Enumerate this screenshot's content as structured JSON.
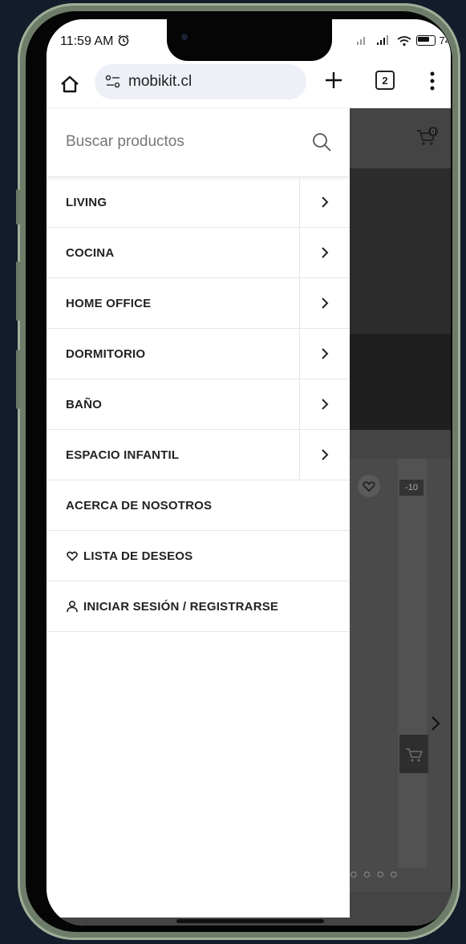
{
  "status_bar": {
    "time": "11:59 AM",
    "battery": "74"
  },
  "browser": {
    "url": "mobikit.cl",
    "tab_count": "2"
  },
  "drawer": {
    "search_placeholder": "Buscar productos",
    "menu": [
      {
        "label": "LIVING",
        "has_submenu": true
      },
      {
        "label": "COCINA",
        "has_submenu": true
      },
      {
        "label": "HOME OFFICE",
        "has_submenu": true
      },
      {
        "label": "DORMITORIO",
        "has_submenu": true
      },
      {
        "label": "BAÑO",
        "has_submenu": true
      },
      {
        "label": "ESPACIO INFANTIL",
        "has_submenu": true
      },
      {
        "label": "ACERCA DE NOSOTROS",
        "has_submenu": false
      },
      {
        "label": "LISTA DE DESEOS",
        "icon": "heart-icon",
        "has_submenu": false
      },
      {
        "label": "INICIAR SESIÓN / REGISTRARSE",
        "icon": "user-icon",
        "has_submenu": false
      }
    ]
  },
  "background_page": {
    "cart_count": "0",
    "discount_badge": "-10"
  },
  "colors": {
    "overlay": "#444444",
    "drawer": "#ffffff",
    "text": "#222222"
  }
}
